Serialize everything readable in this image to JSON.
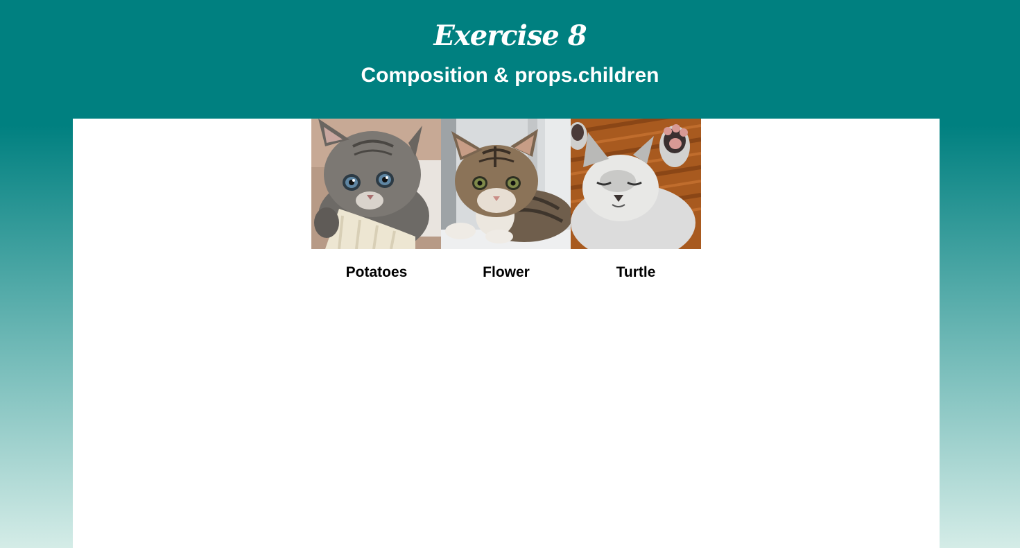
{
  "header": {
    "title": "Exercise 8",
    "subtitle": "Composition & props.children"
  },
  "cats": [
    {
      "name": "Potatoes",
      "image": "kitten-gray-fluffy-photo"
    },
    {
      "name": "Flower",
      "image": "kitten-tabby-photo"
    },
    {
      "name": "Turtle",
      "image": "kitten-white-sleeping-photo"
    }
  ],
  "colors": {
    "header_bg": "#008080",
    "gradient_end": "#d4ece7",
    "panel_bg": "#ffffff",
    "title_text": "#ffffff",
    "label_text": "#000000"
  }
}
